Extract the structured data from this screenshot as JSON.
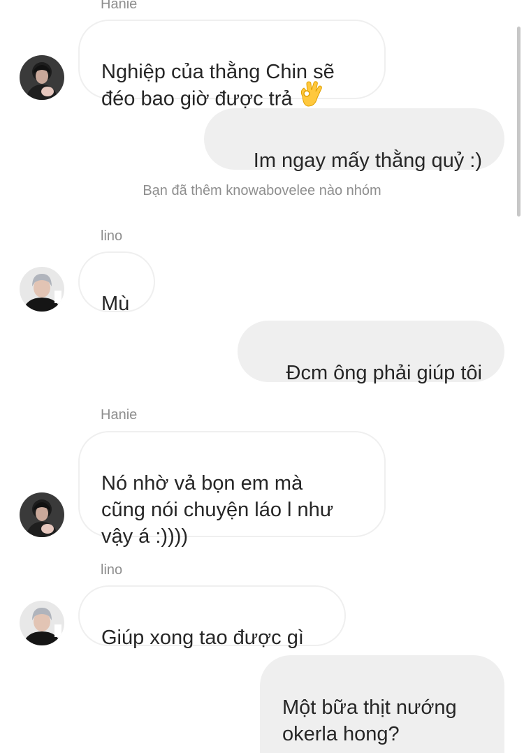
{
  "thread": {
    "top_sender": "Hanie",
    "messages": [
      {
        "who": "Hanie",
        "dir": "in",
        "text": "Nghiệp của thằng Chin sẽ\nđéo bao giờ được trả",
        "emoji": "ok-hand-icon"
      },
      {
        "who": "me",
        "dir": "out",
        "text": "Im ngay mấy thằng quỷ :)"
      },
      {
        "system": "Bạn đã thêm knowabovelee nào nhóm"
      },
      {
        "sender_label": "lino"
      },
      {
        "who": "lino",
        "dir": "in",
        "text": "Mù"
      },
      {
        "who": "me",
        "dir": "out",
        "text": "Đcm ông phải giúp tôi"
      },
      {
        "sender_label": "Hanie"
      },
      {
        "who": "Hanie",
        "dir": "in",
        "text": "Nó nhờ vả bọn em mà\ncũng nói chuyện láo l như\nvậy á :))))"
      },
      {
        "sender_label": "lino"
      },
      {
        "who": "lino",
        "dir": "in",
        "text": "Giúp xong tao được gì"
      },
      {
        "who": "me",
        "dir": "out",
        "text": "Một bữa thịt nướng\nokerla hong?"
      }
    ]
  },
  "colors": {
    "incoming_bg": "#ffffff",
    "incoming_border": "#efefef",
    "outgoing_bg": "#efefef",
    "meta_text": "#8e8e8e",
    "text": "#262626"
  }
}
